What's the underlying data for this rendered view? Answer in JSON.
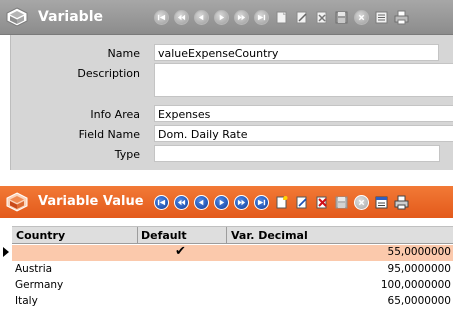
{
  "variable": {
    "title": "Variable",
    "fields": [
      {
        "label": "Name",
        "value": "valueExpenseCountry"
      },
      {
        "label": "Description",
        "value": ""
      },
      {
        "label": "Info Area",
        "value": "Expenses"
      },
      {
        "label": "Field Name",
        "value": "Dom. Daily Rate"
      },
      {
        "label": "Type",
        "value": ""
      }
    ]
  },
  "variable_value": {
    "title": "Variable Value",
    "columns": [
      "Country",
      "Default",
      "Var. Decimal"
    ],
    "rows": [
      {
        "country": "",
        "default": "✔",
        "decimal": "55,0000000",
        "selected": true
      },
      {
        "country": "Austria",
        "default": "",
        "decimal": "95,0000000",
        "selected": false
      },
      {
        "country": "Germany",
        "default": "",
        "decimal": "100,0000000",
        "selected": false
      },
      {
        "country": "Italy",
        "default": "",
        "decimal": "65,0000000",
        "selected": false
      }
    ]
  },
  "icons": {
    "nav": [
      "first-icon",
      "previous-icon",
      "back-icon",
      "next-icon",
      "forward-icon",
      "last-icon"
    ],
    "actions": [
      "new-icon",
      "edit-icon",
      "delete-icon",
      "save-icon",
      "cancel-icon",
      "list-icon",
      "print-icon"
    ]
  },
  "colors": {
    "accent_orange": "#e8621f",
    "header_gray": "#9a9a9a",
    "selected_row": "#fbc9ac"
  }
}
